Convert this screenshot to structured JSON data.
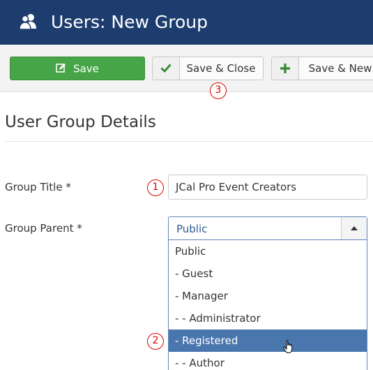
{
  "header": {
    "title": "Users: New Group",
    "icon": "users-icon",
    "background": "#1c3d6e"
  },
  "toolbar": {
    "save_label": "Save",
    "save_close_label": "Save & Close",
    "save_new_label": "Save & New",
    "save_color": "#46a546",
    "icons": [
      "edit-icon",
      "check-icon",
      "plus-icon"
    ]
  },
  "callouts": [
    "1",
    "2",
    "3"
  ],
  "section": {
    "title": "User Group Details"
  },
  "form": {
    "group_title_label": "Group Title *",
    "group_title_value": "JCal Pro Event Creators",
    "group_parent_label": "Group Parent *",
    "group_parent_selected": "Public",
    "group_parent_options": [
      "Public",
      "- Guest",
      "- Manager",
      "- - Administrator",
      "- Registered",
      "- - Author"
    ],
    "highlighted_option": "- Registered",
    "highlight_color": "#4a76ae"
  }
}
